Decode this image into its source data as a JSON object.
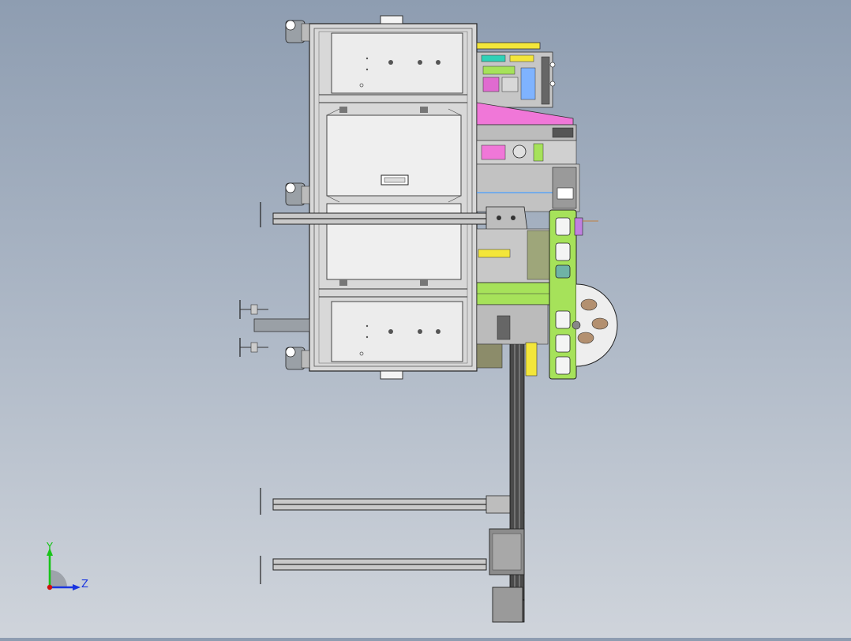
{
  "viewport": {
    "background_top": "#8e9db1",
    "background_bottom": "#cfd4db"
  },
  "triad": {
    "y_label": "Y",
    "z_label": "Z",
    "y_color": "#19c419",
    "z_color": "#1a35e0",
    "x_color": "#d01010"
  },
  "colors": {
    "frame": "#e9e9e9",
    "frame_line": "#3a3a3a",
    "green": "#a6e25a",
    "pink": "#f077d8",
    "yellow": "#f3e63a",
    "teal": "#2fd1b7",
    "rail": "#4a4a4a",
    "motor": "#8c8c8c"
  },
  "icons": [
    "caster-wheel-icon",
    "leveling-foot-icon",
    "axis-triad-icon"
  ]
}
